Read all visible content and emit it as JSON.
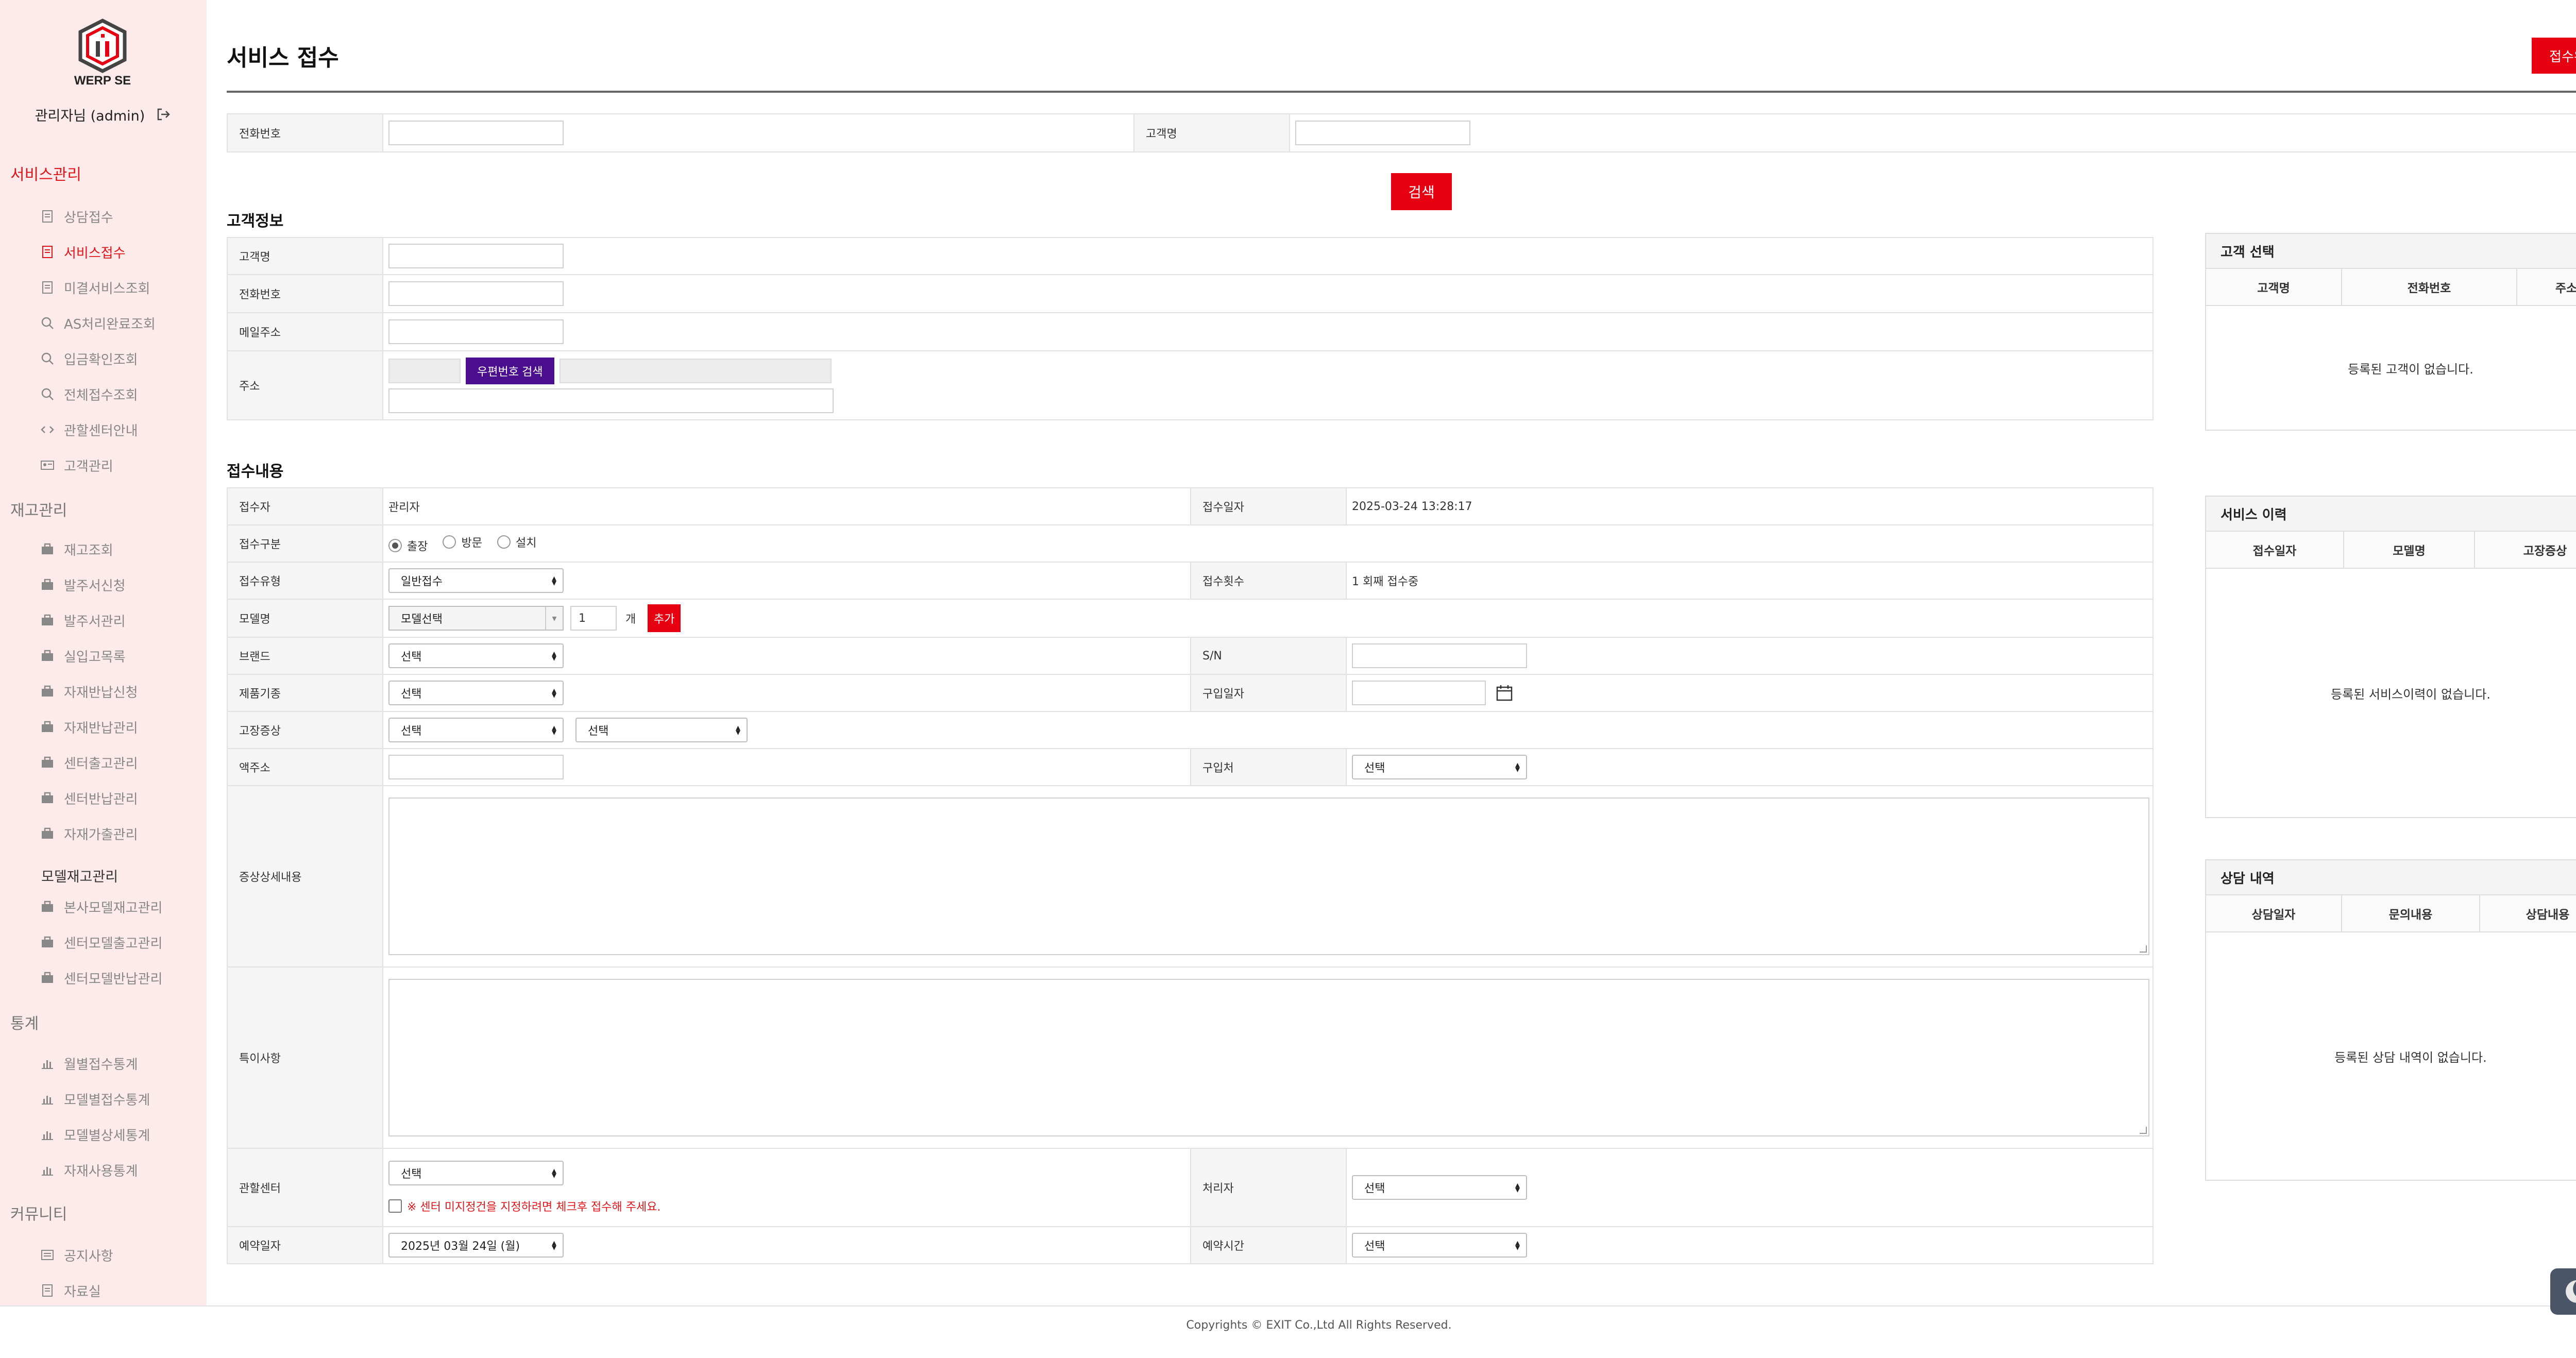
{
  "brand": {
    "name": "WERP SE",
    "accent": "#e60012",
    "sidebar_bg": "#fdeaea"
  },
  "user": {
    "label": "관리자님 (admin)"
  },
  "sidebar": {
    "service_section": "서비스관리",
    "service_items": [
      "상담접수",
      "서비스접수",
      "미결서비스조회",
      "AS처리완료조회",
      "입금확인조회",
      "전체접수조회",
      "관할센터안내",
      "고객관리"
    ],
    "stock_section": "재고관리",
    "stock_items": [
      "재고조회",
      "발주서신청",
      "발주서관리",
      "실입고목록",
      "자재반납신청",
      "자재반납관리",
      "센터출고관리",
      "센터반납관리",
      "자재가출관리"
    ],
    "model_sub": "모델재고관리",
    "model_items": [
      "본사모델재고관리",
      "센터모델출고관리",
      "센터모델반납관리"
    ],
    "stats_section": "통계",
    "stats_items": [
      "월별접수통계",
      "모델별접수통계",
      "모델별상세통계",
      "자재사용통계"
    ],
    "community_section": "커뮤니티",
    "community_items": [
      "공지사항",
      "자료실"
    ]
  },
  "page": {
    "title": "서비스 접수",
    "done_button": "접수완료",
    "search_button": "검색"
  },
  "search": {
    "phone_label": "전화번호",
    "name_label": "고객명"
  },
  "customer": {
    "title": "고객정보",
    "name_label": "고객명",
    "phone_label": "전화번호",
    "email_label": "메일주소",
    "address_label": "주소",
    "zip_button": "우편번호 검색"
  },
  "receipt": {
    "title": "접수내용",
    "receiver_label": "접수자",
    "receiver_value": "관리자",
    "date_label": "접수일자",
    "date_value": "2025-03-24 13:28:17",
    "type_label": "접수구분",
    "type_options": [
      "출장",
      "방문",
      "설치"
    ],
    "kind_label": "접수유형",
    "kind_value": "일반접수",
    "count_label": "접수횟수",
    "count_value": "1 회째 접수중",
    "model_label": "모델명",
    "model_value": "모델선택",
    "qty_value": "1",
    "qty_unit": "개",
    "add_button": "추가",
    "brand_label": "브랜드",
    "brand_value": "선택",
    "sn_label": "S/N",
    "product_label": "제품기종",
    "product_value": "선택",
    "purchase_date_label": "구입일자",
    "symptom_label": "고장증상",
    "symptom_value1": "선택",
    "symptom_value2": "선택",
    "addr_label": "액주소",
    "purchase_place_label": "구입처",
    "purchase_place_value": "선택",
    "detail_label": "증상상세내용",
    "notes_label": "특이사항",
    "center_label": "관할센터",
    "center_value": "선택",
    "center_note": "※ 센터 미지정건을 지정하려면 체크후 접수해 주세요.",
    "handler_label": "처리자",
    "handler_value": "선택",
    "reserve_date_label": "예약일자",
    "reserve_date_value": "2025년 03월 24일 (월)",
    "reserve_time_label": "예약시간",
    "reserve_time_value": "선택"
  },
  "panels": {
    "customer_select": {
      "title": "고객 선택",
      "cols": [
        "고객명",
        "전화번호",
        "주소"
      ],
      "empty": "등록된 고객이 없습니다."
    },
    "service_history": {
      "title": "서비스 이력",
      "cols": [
        "접수일자",
        "모델명",
        "고장증상"
      ],
      "empty": "등록된 서비스이력이 없습니다."
    },
    "consult_history": {
      "title": "상담 내역",
      "cols": [
        "상담일자",
        "문의내용",
        "상담내용"
      ],
      "empty": "등록된 상담 내역이 없습니다."
    }
  },
  "footer": {
    "text": "Copyrights © EXIT Co.,Ltd All Rights Reserved."
  }
}
